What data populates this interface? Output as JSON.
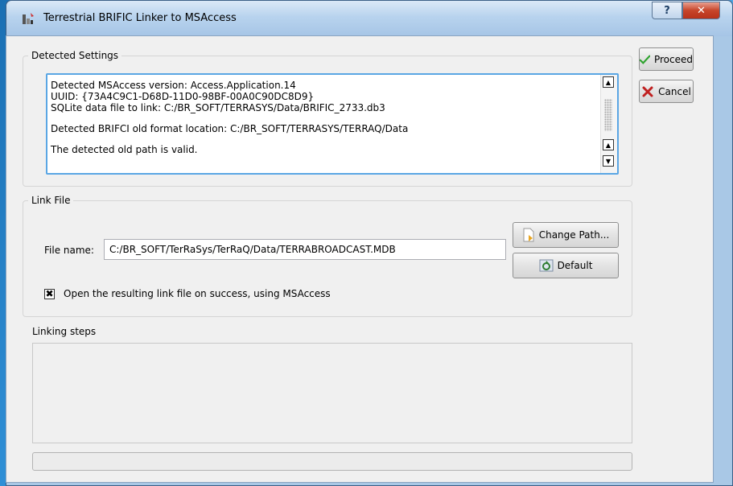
{
  "window": {
    "title": "Terrestrial BRIFIC Linker to MSAccess",
    "help_glyph": "?",
    "close_glyph": "✕"
  },
  "detected": {
    "legend": "Detected Settings",
    "lines": [
      "Detected MSAccess version: Access.Application.14",
      "UUID: {73A4C9C1-D68D-11D0-98BF-00A0C90DC8D9}",
      "SQLite data file to link: C:/BR_SOFT/TERRASYS/Data/BRIFIC_2733.db3",
      "",
      "Detected BRIFCI old format location: C:/BR_SOFT/TERRASYS/TERRAQ/Data",
      "",
      "The detected old path is valid."
    ]
  },
  "buttons": {
    "proceed": "Proceed",
    "cancel": "Cancel",
    "change_path": "Change Path...",
    "default": "Default"
  },
  "link": {
    "legend": "Link File",
    "file_label": "File name:",
    "file_value": "C:/BR_SOFT/TerRaSys/TerRaQ/Data/TERRABROADCAST.MDB",
    "open_checked": true,
    "open_label": "Open the resulting link file on success, using MSAccess"
  },
  "steps": {
    "label": "Linking steps"
  },
  "progress": {
    "value": 0
  },
  "icons": [
    "app-icon",
    "check-icon",
    "cancel-x-icon",
    "folder-arrow-icon",
    "default-reset-icon",
    "scroll-up-icon",
    "scroll-down-icon"
  ],
  "colors": {
    "accent": "#5aa6e4",
    "proceed_check": "#2ea32e",
    "cancel_x": "#c02020"
  }
}
